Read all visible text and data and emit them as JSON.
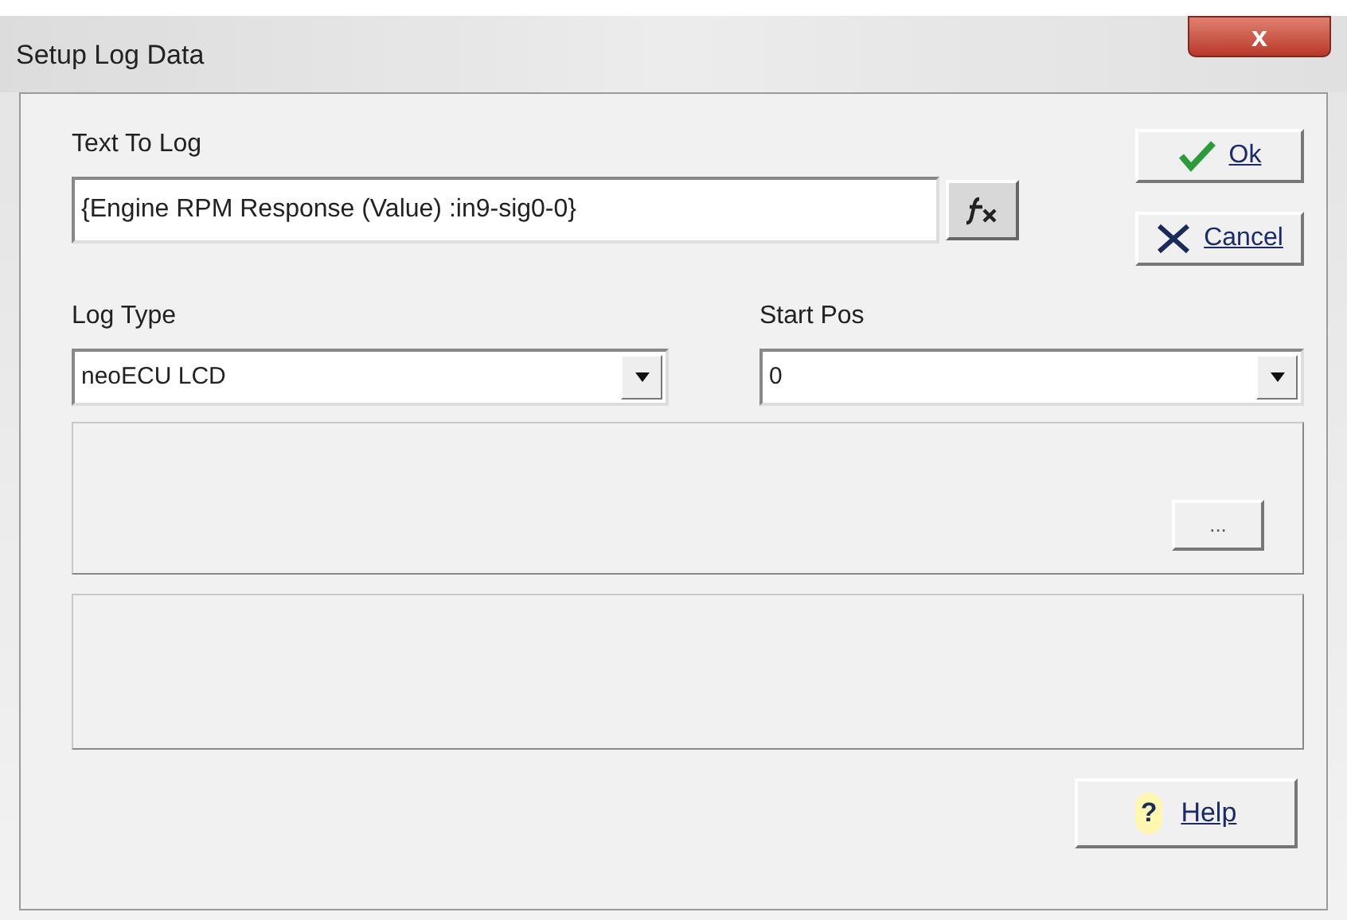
{
  "window": {
    "title": "Setup Log Data",
    "close": "x"
  },
  "text_to_log": {
    "label": "Text To Log",
    "value": "{Engine RPM Response (Value) :in9-sig0-0}"
  },
  "buttons": [
    {
      "kind": "ok",
      "label": "Ok"
    },
    {
      "kind": "cancel",
      "label": "Cancel"
    }
  ],
  "log_type": {
    "label": "Log Type",
    "value": "neoECU LCD"
  },
  "start_pos": {
    "label": "Start Pos",
    "value": "0"
  },
  "browse_button": "...",
  "help_button": {
    "icon": "?",
    "label": "Help"
  }
}
